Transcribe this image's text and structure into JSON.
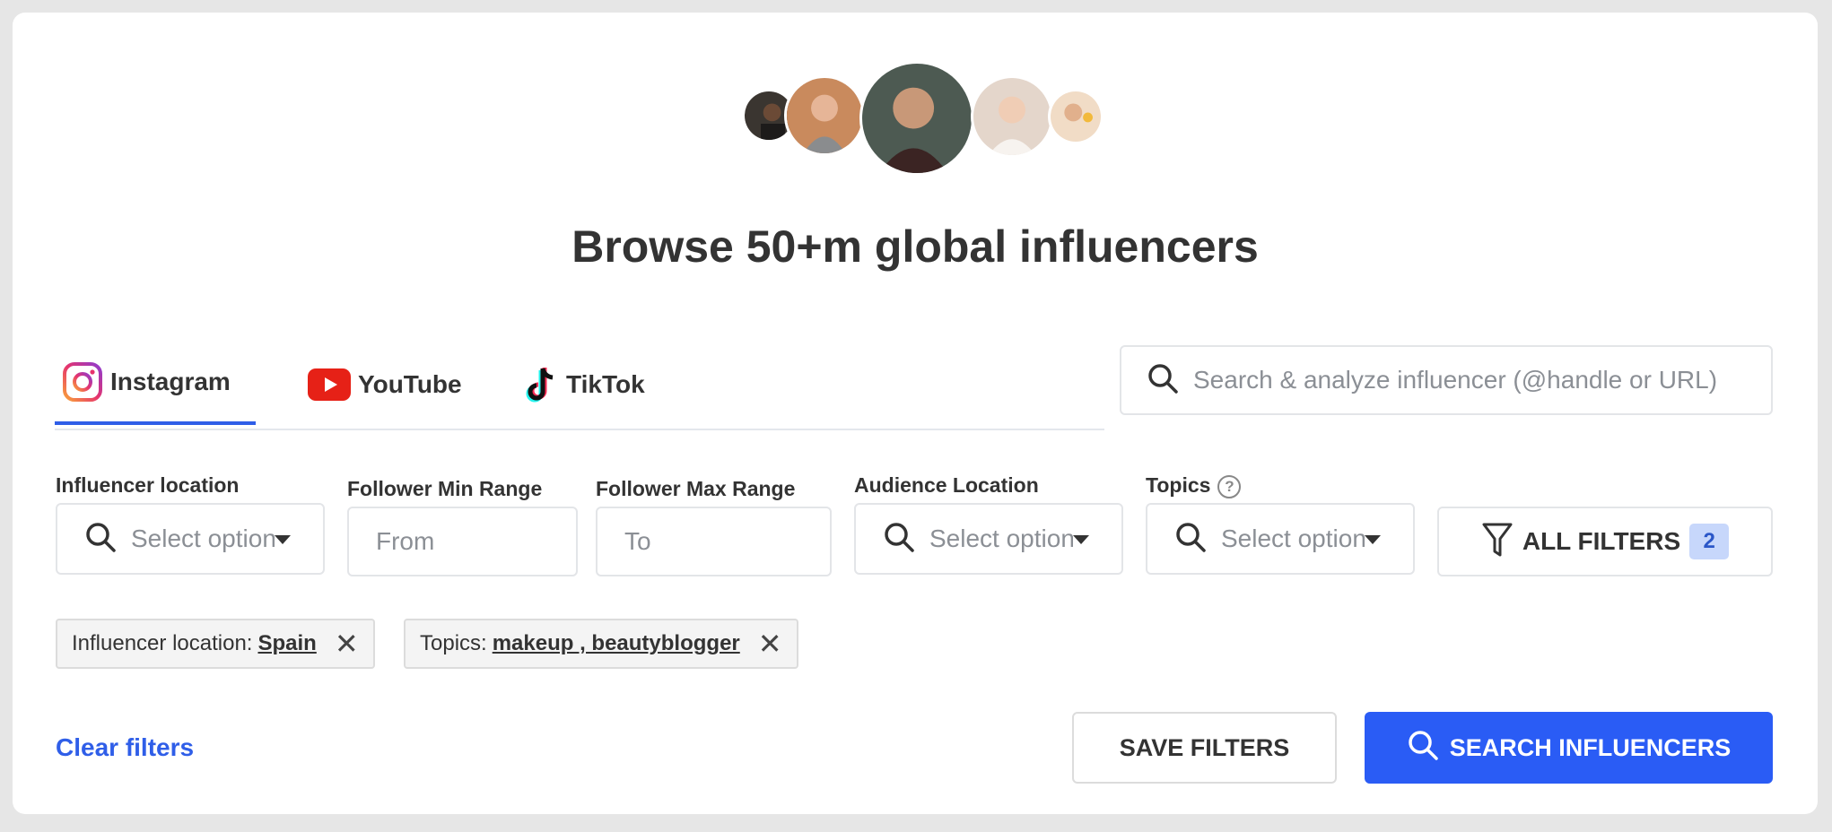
{
  "header": {
    "title": "Browse 50+m global influencers",
    "avatars": [
      {
        "name": "avatar-1",
        "color": "#3a3530"
      },
      {
        "name": "avatar-2",
        "color": "#b87a4f"
      },
      {
        "name": "avatar-3",
        "color": "#4a3b33"
      },
      {
        "name": "avatar-4",
        "color": "#e9ddd3"
      },
      {
        "name": "avatar-5",
        "color": "#e8c7a4"
      }
    ]
  },
  "tabs": [
    {
      "label": "Instagram",
      "icon": "instagram-icon",
      "active": true
    },
    {
      "label": "YouTube",
      "icon": "youtube-icon",
      "active": false
    },
    {
      "label": "TikTok",
      "icon": "tiktok-icon",
      "active": false
    }
  ],
  "search": {
    "placeholder": "Search & analyze influencer (@handle or URL)",
    "icon": "search-icon"
  },
  "filters": {
    "influencer_location": {
      "label": "Influencer location",
      "placeholder": "Select option"
    },
    "follower_min": {
      "label": "Follower Min Range",
      "placeholder": "From"
    },
    "follower_max": {
      "label": "Follower Max Range",
      "placeholder": "To"
    },
    "audience_location": {
      "label": "Audience Location",
      "placeholder": "Select option"
    },
    "topics": {
      "label": "Topics",
      "placeholder": "Select option",
      "help": "?"
    },
    "all_filters": {
      "label": "ALL FILTERS",
      "count": "2"
    }
  },
  "chips": [
    {
      "label": "Influencer location:",
      "value": "Spain"
    },
    {
      "label": "Topics:",
      "value": "makeup , beautyblogger"
    }
  ],
  "actions": {
    "clear": "Clear filters",
    "save": "SAVE FILTERS",
    "search": "SEARCH INFLUENCERS"
  },
  "colors": {
    "accent": "#2a5cf5",
    "tab_underline": "#2f5ee8",
    "badge_bg": "#c7d7fb",
    "youtube": "#e62117"
  }
}
